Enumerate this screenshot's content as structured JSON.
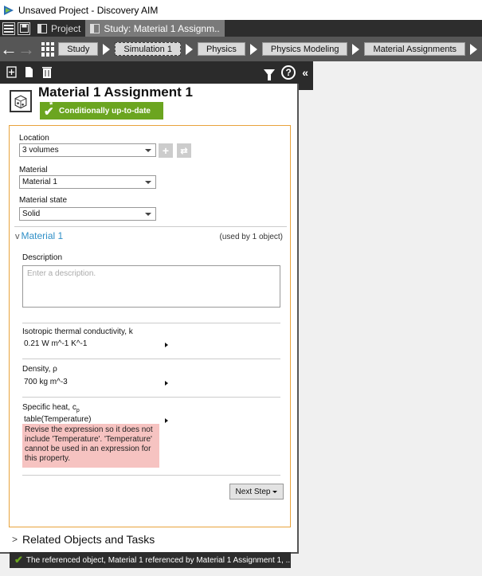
{
  "window": {
    "title": "Unsaved Project - Discovery AIM"
  },
  "tabs": [
    {
      "label": "Project"
    },
    {
      "label": "Study: Material 1 Assignm.."
    }
  ],
  "breadcrumbs": [
    "Study",
    "Simulation 1",
    "Physics",
    "Physics Modeling",
    "Material Assignments"
  ],
  "panel": {
    "title": "Material 1 Assignment 1",
    "status": "Conditionally up-to-date",
    "location_label": "Location",
    "location_value": "3 volumes",
    "material_label": "Material",
    "material_value": "Material 1",
    "state_label": "Material state",
    "state_value": "Solid",
    "material_section": "Material 1",
    "used_by": "(used by 1 object)",
    "description_label": "Description",
    "description_placeholder": "Enter a description.",
    "conductivity_label": "Isotropic thermal conductivity, k",
    "conductivity_value": "0.21 W m^-1 K^-1",
    "density_label": "Density, ρ",
    "density_value": "700 kg m^-3",
    "specific_heat_label": "Specific heat, c",
    "specific_heat_sub": "p",
    "specific_heat_value": "table(Temperature)",
    "error_message": "Revise the expression so it does not include 'Temperature'. 'Temperature' cannot be used in an expression for this property.",
    "next_step": "Next Step",
    "footer_message": "The referenced object, Material 1 referenced by Material 1 Assignment 1, ...",
    "related": "Related Objects and Tasks"
  },
  "colors": {
    "status_green": "#6ba520",
    "link_blue": "#2f8fc7",
    "error_bg": "#f6c3c1",
    "form_border": "#e8a33c"
  }
}
